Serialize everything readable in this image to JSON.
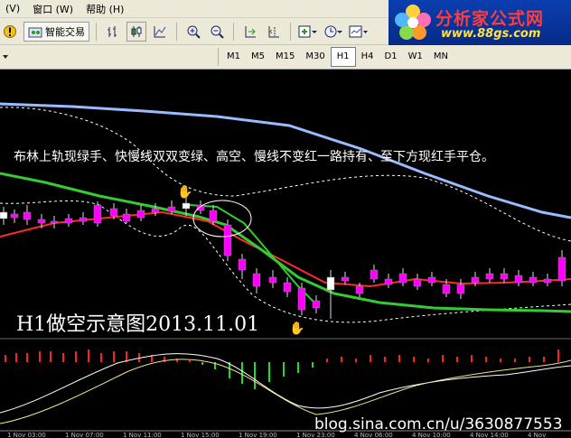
{
  "menu": {
    "items": [
      "(V)",
      "窗口 (W)",
      "帮助 (H)"
    ]
  },
  "toolbar": {
    "smart_trading_label": "智能交易"
  },
  "timeframes": [
    "M1",
    "M5",
    "M15",
    "M30",
    "H1",
    "H4",
    "D1",
    "W1",
    "MN"
  ],
  "active_timeframe": "H1",
  "logo": {
    "title": "分析家公式网",
    "url": "www.88gs.com"
  },
  "chart": {
    "annotation": "布林上轨现绿手、快慢线双双变绿、高空、慢线不变红一路持有、至下方现红手平仓。",
    "title": "H1做空示意图2013.11.01",
    "watermark": "blog.sina.com.cn/u/3630877553",
    "time_labels": [
      "1 Nov 03:00",
      "1 Nov 07:00",
      "1 Nov 11:00",
      "1 Nov 15:00",
      "1 Nov 19:00",
      "1 Nov 23:00",
      "4 Nov 06:00",
      "4 Nov 10:00",
      "4 Nov 14:00",
      "4 Nov"
    ],
    "colors": {
      "background": "#000000",
      "bull_candle": "#ffffff",
      "bear_candle": "#ff00ff",
      "fast_ma": "#33cc33",
      "slow_ma": "#ff2a2a",
      "long_ma": "#99bbff",
      "bollinger": "#ffffff",
      "macd_up": "#ff2020",
      "macd_down": "#22dd22"
    }
  }
}
